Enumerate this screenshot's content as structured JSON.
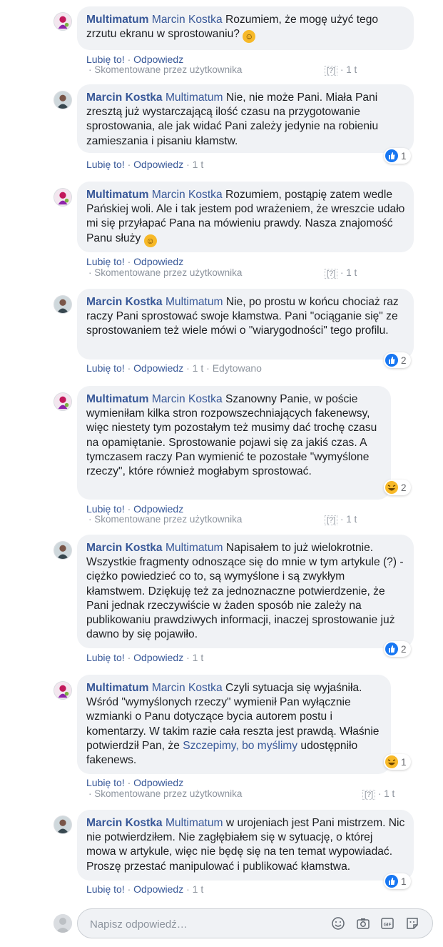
{
  "comments": [
    {
      "author": "Multimatum",
      "mention": "Marcin Kostka",
      "text": " Rozumiem, że mogę użyć tego zrzutu ekranu w sprostowaniu? ",
      "emoji_name": "smiling-face-emoji",
      "like_label": "Lubię to!",
      "reply_label": "Odpowiedz",
      "commented_by": "· Skomentowane przez użytkownika",
      "time": "1 t",
      "qmark": "[?]"
    },
    {
      "author": "Marcin Kostka",
      "mention": "Multimatum",
      "text": " Nie, nie może Pani. Miała Pani zresztą już wystarczającą ilość czasu na przygotowanie sprostowania, ale jak widać Pani zależy jedynie na robieniu zamieszania i pisaniu kłamstw.",
      "like_label": "Lubię to!",
      "reply_label": "Odpowiedz",
      "time": "1 t",
      "reaction_count": "1",
      "reaction_type": "like-reaction-icon"
    },
    {
      "author": "Multimatum",
      "mention": "Marcin Kostka",
      "text": " Rozumiem, postąpię zatem wedle Pańskiej woli. Ale i tak jestem pod wrażeniem, że wreszcie udało mi się przyłapać Pana na mówieniu prawdy. Nasza znajomość Panu służy ",
      "emoji_name": "relieved-face-emoji",
      "like_label": "Lubię to!",
      "reply_label": "Odpowiedz",
      "commented_by": "· Skomentowane przez użytkownika",
      "time": "1 t",
      "qmark": "[?]"
    },
    {
      "author": "Marcin Kostka",
      "mention": "Multimatum",
      "text": " Nie, po prostu w końcu chociaż raz raczy Pani sprostować swoje kłamstwa. Pani \"ociąganie się\" ze sprostowaniem też wiele mówi o \"wiarygodności\" tego profilu.",
      "like_label": "Lubię to!",
      "reply_label": "Odpowiedz",
      "time": "1 t",
      "edited": "Edytowano",
      "reaction_count": "2",
      "reaction_type": "like-reaction-icon"
    },
    {
      "author": "Multimatum",
      "mention": "Marcin Kostka",
      "text": " Szanowny Panie, w poście wymieniłam kilka stron rozpowszechniających fakenewsy, więc niestety tym pozostałym też musimy dać trochę czasu na opamiętanie. Sprostowanie pojawi się za jakiś czas. A tymczasem raczy Pan wymienić te pozostałe \"wymyślone rzeczy\", które również mogłabym sprostować.",
      "like_label": "Lubię to!",
      "reply_label": "Odpowiedz",
      "commented_by": "· Skomentowane przez użytkownika",
      "time": "1 t",
      "qmark": "[?]",
      "reaction_count": "2",
      "reaction_type": "haha-reaction-icon"
    },
    {
      "author": "Marcin Kostka",
      "mention": "Multimatum",
      "text": " Napisałem to już wielokrotnie. Wszystkie fragmenty odnoszące się do mnie w tym artykule (?) - ciężko powiedzieć co to, są wymyślone i są zwykłym kłamstwem. Dziękuję też za jednoznaczne potwierdzenie, że Pani jednak rzeczywiście w żaden sposób nie zależy na publikowaniu prawdziwych informacji, inaczej sprostowanie już dawno by się pojawiło.",
      "like_label": "Lubię to!",
      "reply_label": "Odpowiedz",
      "time": "1 t",
      "reaction_count": "2",
      "reaction_type": "like-reaction-icon"
    },
    {
      "author": "Multimatum",
      "mention": "Marcin Kostka",
      "text": " Czyli sytuacja się wyjaśniła. Wśród \"wymyślonych rzeczy\" wymienił Pan wyłącznie wzmianki o Panu dotyczące bycia autorem postu i komentarzy. W takim razie cała reszta jest prawdą. Właśnie potwierdził Pan, że ",
      "link": "Szczepimy, bo myślimy",
      "text_after": " udostępniło fakenews.",
      "like_label": "Lubię to!",
      "reply_label": "Odpowiedz",
      "commented_by": "· Skomentowane przez użytkownika",
      "time": "1 t",
      "qmark": "[?]",
      "reaction_count": "1",
      "reaction_type": "haha-reaction-icon"
    },
    {
      "author": "Marcin Kostka",
      "mention": "Multimatum",
      "text": " w urojeniach jest Pani mistrzem. Nic nie potwierdziłem. Nie zagłębiałem się w sytuację, o której mowa w artykule, więc nie będę się na ten temat wypowiadać. Proszę przestać manipulować i publikować kłamstwa.",
      "like_label": "Lubię to!",
      "reply_label": "Odpowiedz",
      "time": "1 t",
      "reaction_count": "1",
      "reaction_type": "like-reaction-icon"
    }
  ],
  "reply_box": {
    "placeholder": "Napisz odpowiedź…",
    "tools": [
      "emoji-icon",
      "camera-icon",
      "gif-icon",
      "sticker-icon"
    ]
  },
  "colors": {
    "link_blue": "#385898",
    "bubble_bg": "#f0f2f5",
    "meta_grey": "#8d949e",
    "like_blue": "#1877f2",
    "emoji_yellow": "#f7b928"
  }
}
